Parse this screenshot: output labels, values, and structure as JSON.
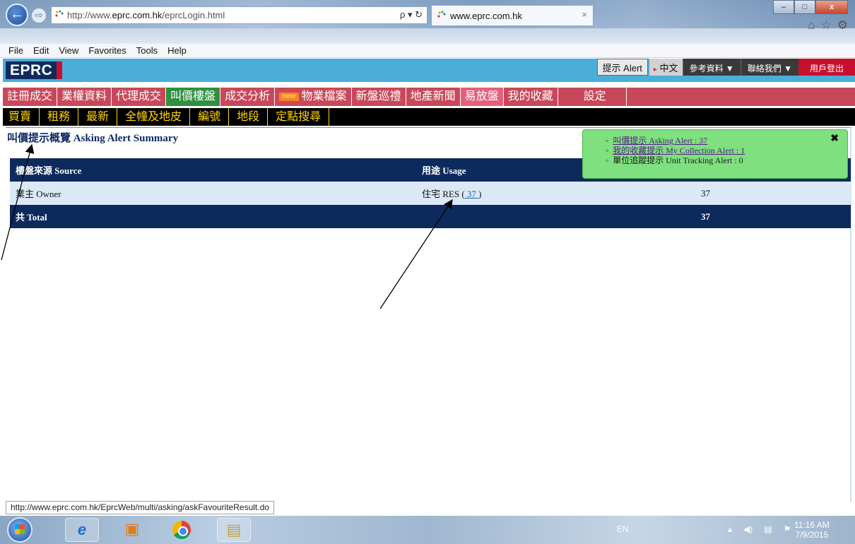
{
  "browser": {
    "address": {
      "prefix": "http://www.",
      "host": "eprc.com.hk",
      "path": "/eprcLogin.html",
      "tools": "ρ ▾ ↻"
    },
    "tab": {
      "title": "www.eprc.com.hk",
      "close": "×"
    },
    "window_buttons": {
      "minimize": "–",
      "maximize": "□",
      "close": "x"
    },
    "toolbar_icons": {
      "home": "⌂",
      "favorites": "☆",
      "settings": "⚙"
    },
    "menu": [
      "File",
      "Edit",
      "View",
      "Favorites",
      "Tools",
      "Help"
    ],
    "back": "←",
    "forward": "⇨"
  },
  "site": {
    "logo": "EPRC",
    "header": {
      "alert_button": "提示 Alert",
      "lang": {
        "arrow": "▸",
        "label": "中文"
      },
      "links": [
        "參考資料 ▼",
        "聯絡我們 ▼"
      ],
      "logout": "用戶登出"
    },
    "main_nav": [
      {
        "label": "註冊成交"
      },
      {
        "label": "業權資料"
      },
      {
        "label": "代理成交"
      },
      {
        "label": "叫價樓盤"
      },
      {
        "label": "成交分析"
      },
      {
        "label": "物業檔案",
        "badge": "new"
      },
      {
        "label": "新盤巡禮"
      },
      {
        "label": "地產新聞"
      },
      {
        "label": "易放盤"
      },
      {
        "label": "我的收藏"
      },
      {
        "label": "設定"
      }
    ],
    "sub_nav": [
      "買賣",
      "租務",
      "最新",
      "全幢及地皮",
      "編號",
      "地段",
      "定點搜尋"
    ]
  },
  "page": {
    "title": "叫價提示概覽 Asking Alert Summary",
    "table": {
      "headers": {
        "source": "樓盤來源 Source",
        "usage": "用途 Usage"
      },
      "rows": [
        {
          "source": "業主 Owner",
          "usage_prefix": "住宅 RES (",
          "usage_link": " 37 ",
          "usage_suffix": ")",
          "count": "37"
        }
      ],
      "total": {
        "label": "共 Total",
        "count": "37"
      }
    },
    "alert_popup": {
      "items": [
        {
          "text": "叫價提示 Asking Alert : 37",
          "link": true
        },
        {
          "text": "我的收藏提示 My Collection Alert : 1",
          "link": true
        },
        {
          "text": "單位追蹤提示 Unit Tracking Alert : 0",
          "link": false
        }
      ],
      "close": "✖"
    }
  },
  "status_bar": {
    "url": "http://www.eprc.com.hk/EprcWeb/multi/asking/askFavouriteResult.do"
  },
  "taskbar": {
    "language": "EN",
    "tray_icons": {
      "up": "▴",
      "volume": "◀)",
      "network": "▤",
      "flag": "⚑"
    },
    "time": "11:16 AM",
    "date": "7/9/2015",
    "apps": {
      "ie": "e",
      "media": "▣",
      "explorer": "▤"
    }
  },
  "colors": {
    "header_blue": "#4baed9",
    "logo_navy": "#0f2b5e",
    "nav_red": "#c8485a",
    "nav_active_green": "#2f8f3f",
    "subnav_text_yellow": "#ffd400",
    "table_navy": "#0d2a5c",
    "row_light_blue": "#dbe9f7",
    "popup_green": "#7ee07e"
  }
}
